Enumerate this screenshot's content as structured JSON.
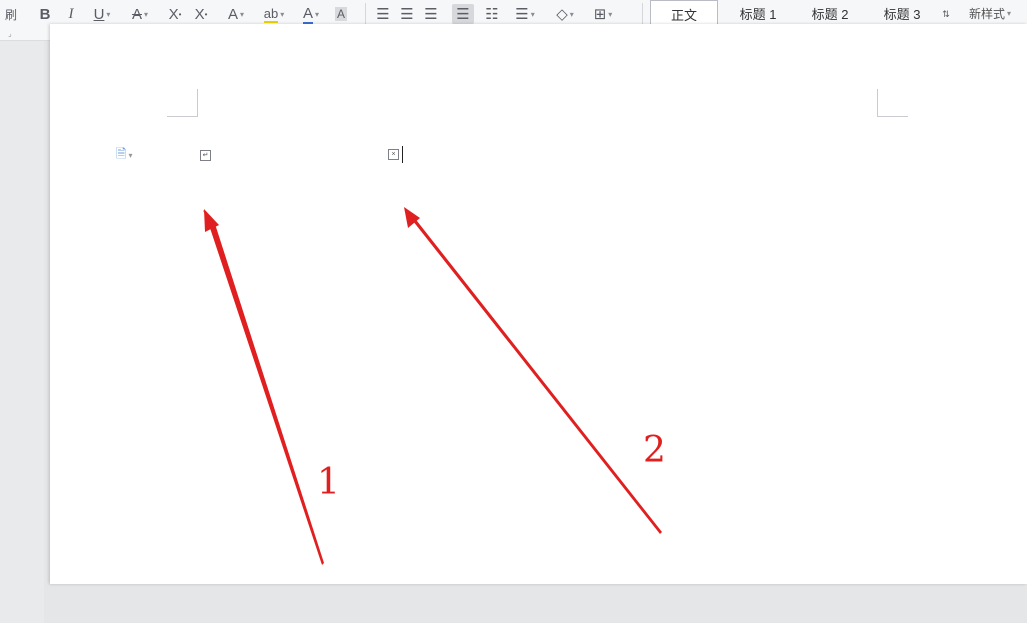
{
  "toolbar": {
    "left_char": "刷",
    "bold": "B",
    "italic": "I",
    "underline": "U",
    "strike": "A",
    "superscript": "X",
    "subscript": "X",
    "emphasis": "A",
    "highlight": "ab",
    "font_color": "A",
    "char_shade": "A",
    "style_normal": "正文",
    "style_h1": "标题 1",
    "style_h2": "标题 2",
    "style_h3": "标题 3",
    "new_style": "新样式"
  },
  "annotations": {
    "label_1": "1",
    "label_2": "2",
    "arrow_color": "#e02020"
  },
  "colors": {
    "accent_red": "#e02020",
    "page_bg": "#ffffff",
    "canvas_bg": "#e5e6e8",
    "paste_icon": "#6f9fdc"
  }
}
